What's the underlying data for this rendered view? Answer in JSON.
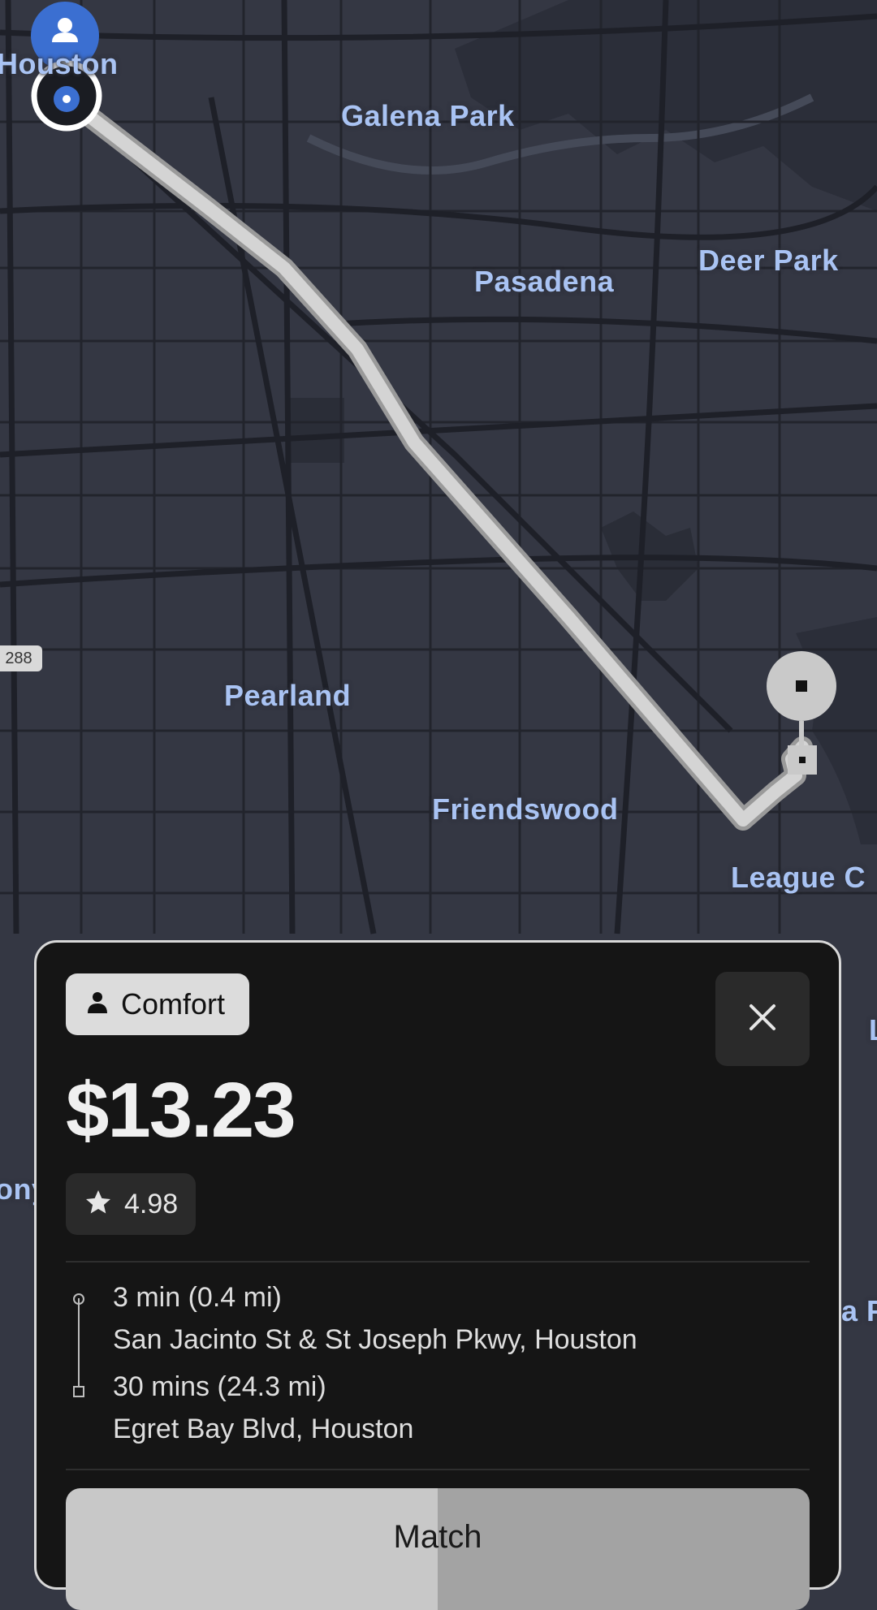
{
  "map": {
    "labels": {
      "houston": "Houston",
      "galena_park": "Galena Park",
      "pasadena": "Pasadena",
      "deer_park": "Deer Park",
      "pearland": "Pearland",
      "friendswood": "Friendswood",
      "league_city": "League C",
      "partial_ony": "ony",
      "partial_a": "a F",
      "partial_edge": "L"
    },
    "highway_shield": "288",
    "colors": {
      "background": "#343743",
      "roads": "#1f2129",
      "route": "#c9c9c9",
      "driver_pin": "#3b6fd1",
      "label": "#a9c3f3"
    }
  },
  "ride_card": {
    "ride_type": "Comfort",
    "price": "$13.23",
    "rating": "4.98",
    "pickup": {
      "eta": "3 min (0.4 mi)",
      "address": "San Jacinto St & St Joseph Pkwy, Houston"
    },
    "dropoff": {
      "eta": "30 mins (24.3 mi)",
      "address": "Egret Bay Blvd, Houston"
    },
    "match_label": "Match",
    "match_progress": 0.5
  },
  "icons": {
    "person": "person-icon",
    "close": "close-icon",
    "star": "star-icon"
  }
}
